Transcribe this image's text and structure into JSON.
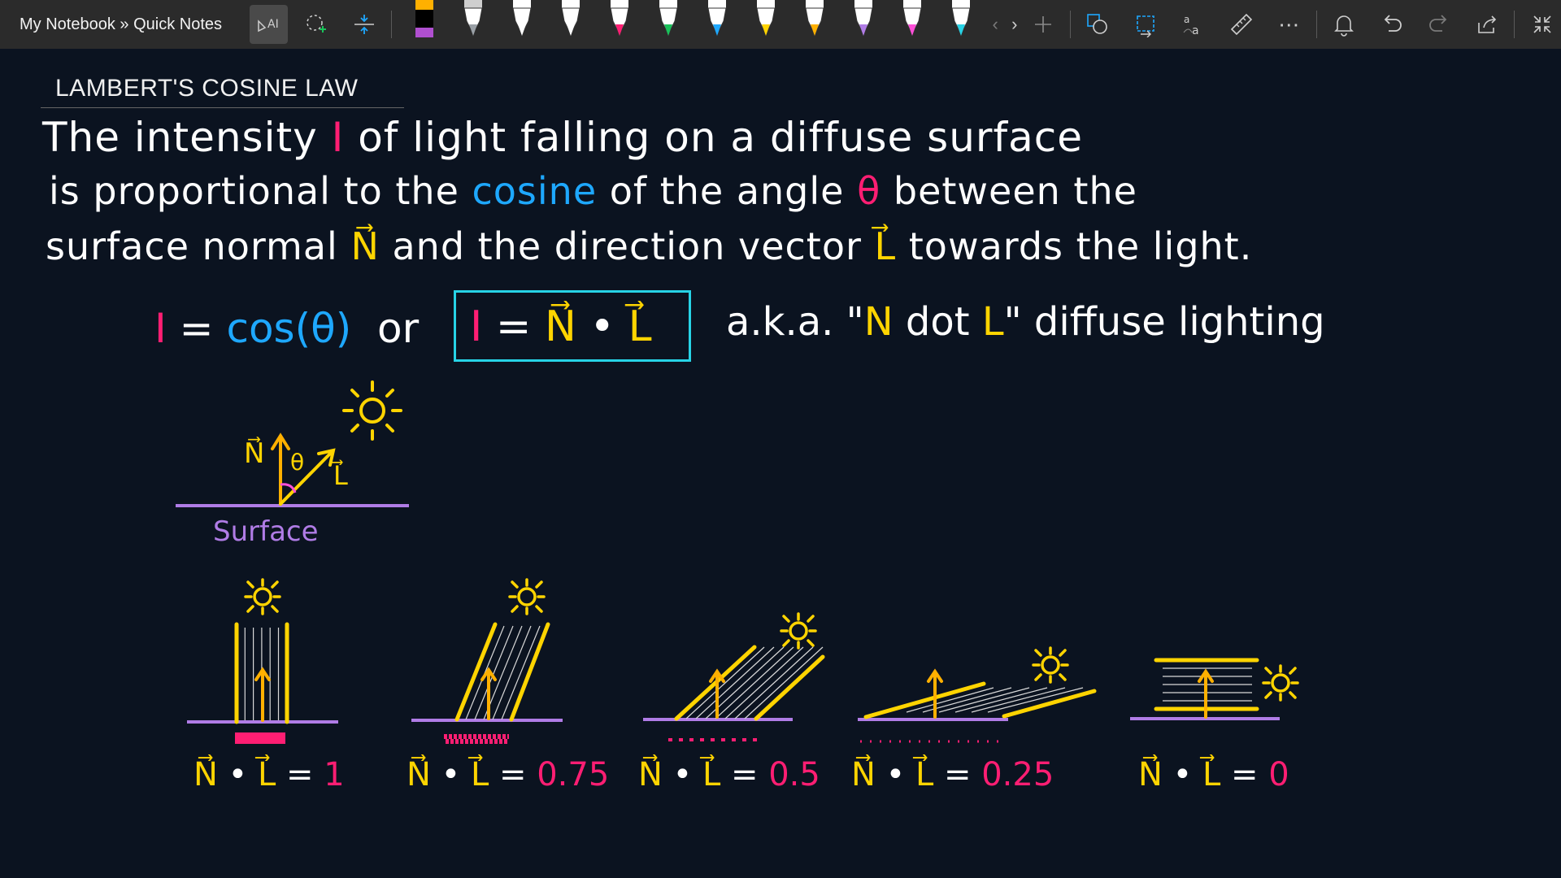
{
  "breadcrumb": {
    "notebook": "My Notebook",
    "separator": " » ",
    "section": "Quick Notes"
  },
  "toolbar": {
    "tools": [
      {
        "name": "ink-to-text-icon",
        "active": true
      },
      {
        "name": "lasso-select-icon"
      },
      {
        "name": "add-space-icon"
      }
    ],
    "pens": [
      {
        "name": "pen-black-purple",
        "tip": "#000000",
        "cap": "#b04fd0",
        "kind": "highlighter"
      },
      {
        "name": "pen-gray",
        "tip": "#9aa0a6",
        "cap": "#cfcfcf"
      },
      {
        "name": "pen-white",
        "tip": "#ffffff",
        "cap": "#ffffff"
      },
      {
        "name": "pen-white-2",
        "tip": "#ffffff",
        "cap": "#ffffff"
      },
      {
        "name": "pen-pink",
        "tip": "#ff1e73",
        "cap": "#ffffff"
      },
      {
        "name": "pen-green",
        "tip": "#19c25a",
        "cap": "#ffffff"
      },
      {
        "name": "pen-blue",
        "tip": "#1ea8ff",
        "cap": "#ffffff"
      },
      {
        "name": "pen-yellow",
        "tip": "#ffd400",
        "cap": "#ffffff"
      },
      {
        "name": "pen-orange",
        "tip": "#ffb000",
        "cap": "#ffffff"
      },
      {
        "name": "pen-purple",
        "tip": "#b07ce6",
        "cap": "#ffffff"
      },
      {
        "name": "pen-magenta",
        "tip": "#ff4fd8",
        "cap": "#ffffff"
      },
      {
        "name": "pen-cyan",
        "tip": "#27d3e6",
        "cap": "#ffffff"
      }
    ],
    "right_tools": [
      "shapes-icon",
      "convert-icon",
      "math-icon",
      "ruler-icon",
      "more-icon",
      "notification-icon",
      "undo-icon",
      "redo-icon",
      "share-icon",
      "collapse-icon"
    ],
    "more_label": "⋯"
  },
  "page": {
    "heading": "LAMBERT'S COSINE LAW",
    "line1": {
      "a": "The intensity ",
      "I": "I",
      "b": " of light falling on a diffuse surface"
    },
    "line2": {
      "a": "is proportional to the ",
      "cos": "cosine",
      "b": " of the angle ",
      "theta": "θ",
      "c": " between the"
    },
    "line3": {
      "a": "surface normal ",
      "N": "N⃗",
      "b": " and the direction vector ",
      "L": "L⃗",
      "c": " towards the light."
    },
    "formula": {
      "I": "I",
      "eq": "=",
      "cos": "cos(θ)",
      "or": "or"
    },
    "boxed": {
      "I": "I",
      "eq": "=",
      "N": "N⃗",
      "dot": "•",
      "L": "L⃗"
    },
    "aka": {
      "a": "a.k.a. \"",
      "N": "N",
      "b": " dot ",
      "L": "L",
      "c": "\" diffuse lighting"
    }
  },
  "diagram": {
    "n_label": "N⃗",
    "theta": "θ",
    "l_label": "L⃗",
    "surface_label": "Surface"
  },
  "examples": [
    {
      "lhs_N": "N⃗",
      "lhs_dot": "•",
      "lhs_L": "L⃗",
      "eq": "=",
      "value": "1"
    },
    {
      "lhs_N": "N⃗",
      "lhs_dot": "•",
      "lhs_L": "L⃗",
      "eq": "=",
      "value": "0.75"
    },
    {
      "lhs_N": "N⃗",
      "lhs_dot": "•",
      "lhs_L": "L⃗",
      "eq": "=",
      "value": "0.5"
    },
    {
      "lhs_N": "N⃗",
      "lhs_dot": "•",
      "lhs_L": "L⃗",
      "eq": "=",
      "value": "0.25"
    },
    {
      "lhs_N": "N⃗",
      "lhs_dot": "•",
      "lhs_L": "L⃗",
      "eq": "=",
      "value": "0"
    }
  ],
  "colors": {
    "pink": "#ff1e73",
    "blue": "#1ea8ff",
    "yellow": "#ffd400",
    "orange": "#ffb000",
    "purple": "#b07ce6",
    "cyan": "#27d3e6"
  }
}
